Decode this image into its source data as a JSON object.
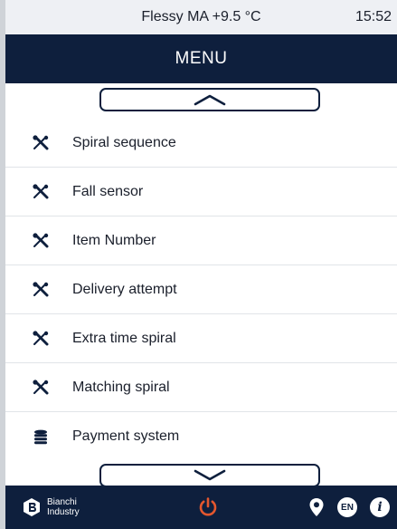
{
  "status_bar": {
    "title": "Flessy MA +9.5 °C",
    "time": "15:52"
  },
  "header": {
    "title": "MENU"
  },
  "menu": {
    "items": [
      {
        "label": "Spiral sequence",
        "icon": "wrench-screwdriver-icon"
      },
      {
        "label": "Fall sensor",
        "icon": "wrench-screwdriver-icon"
      },
      {
        "label": "Item Number",
        "icon": "wrench-screwdriver-icon"
      },
      {
        "label": "Delivery attempt",
        "icon": "wrench-screwdriver-icon"
      },
      {
        "label": "Extra time spiral",
        "icon": "wrench-screwdriver-icon"
      },
      {
        "label": "Matching spiral",
        "icon": "wrench-screwdriver-icon"
      },
      {
        "label": "Payment system",
        "icon": "coins-icon"
      }
    ]
  },
  "footer": {
    "brand_line1": "Bianchi",
    "brand_line2": "Industry",
    "language": "EN",
    "info_glyph": "i"
  },
  "colors": {
    "navy": "#0e1f3d",
    "power_accent": "#e4572e",
    "divider": "#e1e4e8"
  }
}
